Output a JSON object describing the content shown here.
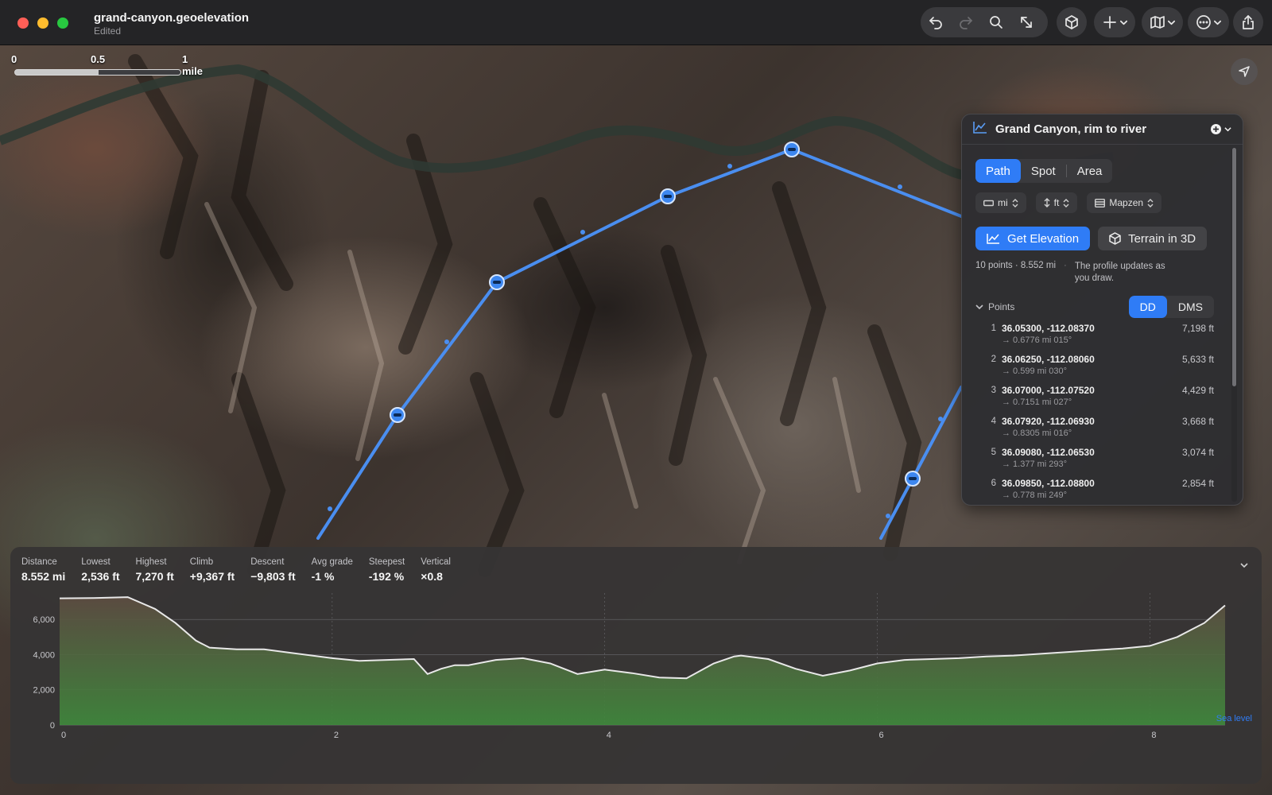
{
  "window": {
    "title": "grand-canyon.geoelevation",
    "subtitle": "Edited"
  },
  "toolbar": {
    "icons": [
      "undo-icon",
      "redo-icon",
      "search-icon",
      "resize-icon",
      "cube-icon",
      "plus-icon",
      "map-icon",
      "ellipsis-icon",
      "share-icon"
    ]
  },
  "map": {
    "scale": {
      "label_0": "0",
      "label_half": "0.5",
      "label_full": "1 mile"
    },
    "route_color": "#4a8ef0"
  },
  "panel": {
    "title": "Grand Canyon, rim to river",
    "modes": {
      "path": "Path",
      "spot": "Spot",
      "area": "Area"
    },
    "pills": {
      "distance_unit": "mi",
      "elevation_unit": "ft",
      "source": "Mapzen"
    },
    "actions": {
      "get_elevation": "Get Elevation",
      "terrain_3d": "Terrain in 3D"
    },
    "summary": "10 points · 8.552 mi",
    "note": "The profile updates as you draw.",
    "points_label": "Points",
    "format": {
      "dd": "DD",
      "dms": "DMS"
    },
    "points": [
      {
        "idx": "1",
        "coord": "36.05300, -112.08370",
        "elev": "7,198 ft",
        "leg": "→ 0.6776 mi  015°"
      },
      {
        "idx": "2",
        "coord": "36.06250, -112.08060",
        "elev": "5,633 ft",
        "leg": "→ 0.599 mi  030°"
      },
      {
        "idx": "3",
        "coord": "36.07000, -112.07520",
        "elev": "4,429 ft",
        "leg": "→ 0.7151 mi  027°"
      },
      {
        "idx": "4",
        "coord": "36.07920, -112.06930",
        "elev": "3,668 ft",
        "leg": "→ 0.8305 mi  016°"
      },
      {
        "idx": "5",
        "coord": "36.09080, -112.06530",
        "elev": "3,074 ft",
        "leg": "→ 1.377 mi  293°"
      },
      {
        "idx": "6",
        "coord": "36.09850, -112.08800",
        "elev": "2,854 ft",
        "leg": "→ 0.778 mi  249°"
      }
    ]
  },
  "profile": {
    "stats": [
      {
        "label": "Distance",
        "value": "8.552 mi"
      },
      {
        "label": "Lowest",
        "value": "2,536 ft"
      },
      {
        "label": "Highest",
        "value": "7,270 ft"
      },
      {
        "label": "Climb",
        "value": "+9,367 ft"
      },
      {
        "label": "Descent",
        "value": "−9,803 ft"
      },
      {
        "label": "Avg grade",
        "value": "-1 %"
      },
      {
        "label": "Steepest",
        "value": "-192 %"
      },
      {
        "label": "Vertical",
        "value": "×0.8"
      }
    ],
    "sea_level_label": "Sea level"
  },
  "chart_data": {
    "type": "area",
    "x": [
      0,
      0.25,
      0.5,
      0.7,
      0.85,
      1.0,
      1.1,
      1.3,
      1.5,
      1.7,
      2.0,
      2.2,
      2.4,
      2.6,
      2.7,
      2.8,
      2.9,
      3.0,
      3.2,
      3.4,
      3.6,
      3.8,
      4.0,
      4.2,
      4.4,
      4.6,
      4.8,
      4.95,
      5.0,
      5.2,
      5.4,
      5.6,
      5.8,
      6.0,
      6.2,
      6.4,
      6.6,
      6.8,
      7.0,
      7.2,
      7.4,
      7.6,
      7.8,
      8.0,
      8.2,
      8.4,
      8.552
    ],
    "y": [
      7200,
      7220,
      7270,
      6600,
      5800,
      4800,
      4400,
      4300,
      4300,
      4100,
      3800,
      3650,
      3700,
      3750,
      2900,
      3200,
      3400,
      3400,
      3700,
      3800,
      3500,
      2900,
      3150,
      2950,
      2700,
      2650,
      3500,
      3900,
      3950,
      3750,
      3200,
      2800,
      3100,
      3500,
      3700,
      3750,
      3800,
      3900,
      3950,
      4050,
      4150,
      4250,
      4350,
      4500,
      5000,
      5800,
      6800
    ],
    "xlim": [
      0,
      8.552
    ],
    "ylim": [
      0,
      7500
    ],
    "xticks": [
      "0",
      "2",
      "4",
      "6",
      "8"
    ],
    "yticks": [
      "0",
      "2,000",
      "4,000",
      "6,000"
    ],
    "xtick_values": [
      0,
      2,
      4,
      6,
      8
    ],
    "ytick_values": [
      0,
      2000,
      4000,
      6000
    ],
    "line_color": "#e8e8e8",
    "fill_top": "#5e4d42",
    "fill_bottom": "#3f8a3c",
    "grid": true
  }
}
